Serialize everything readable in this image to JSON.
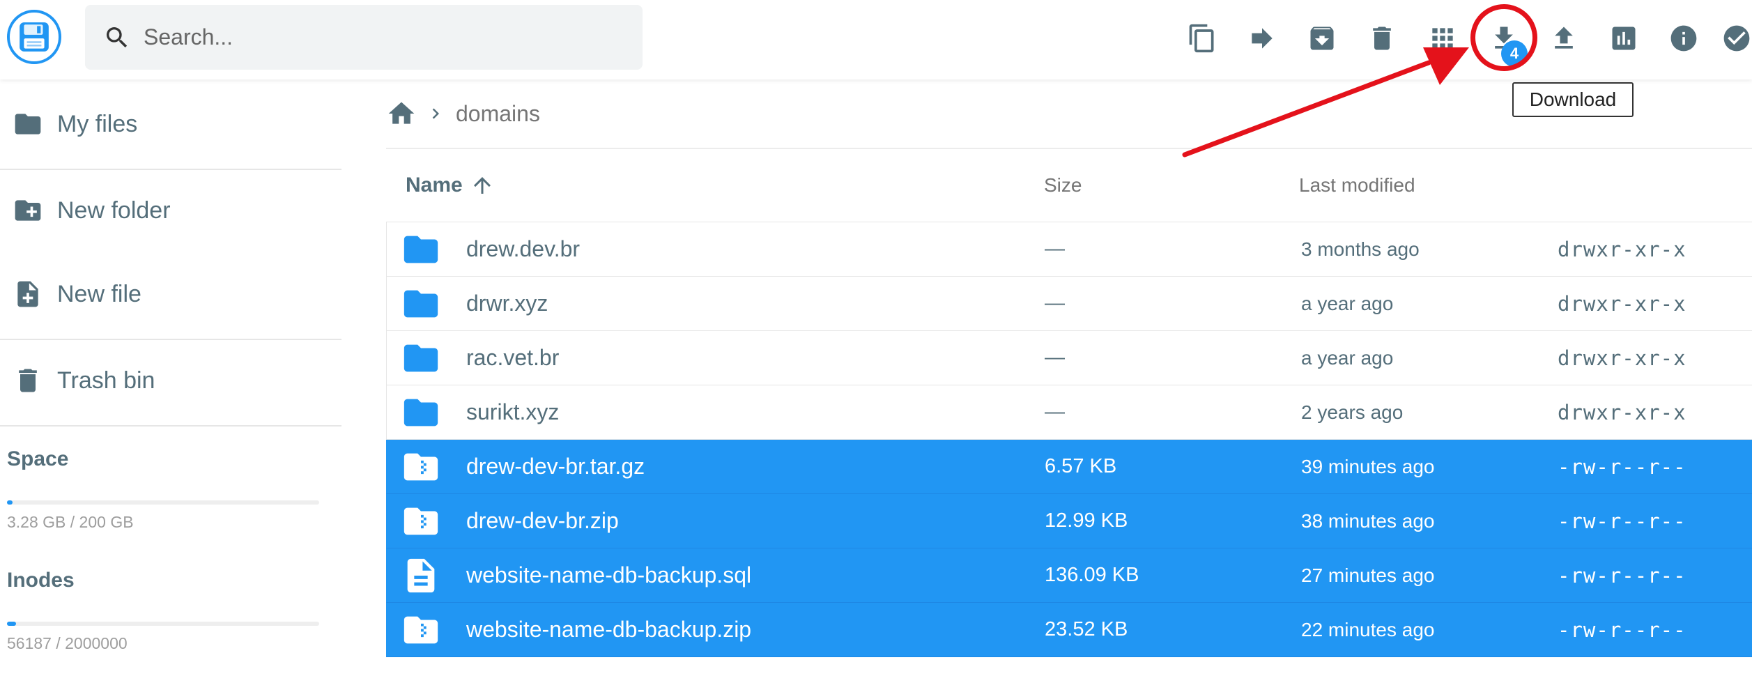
{
  "header": {
    "search_placeholder": "Search...",
    "download_badge": "4",
    "tooltip": "Download",
    "actions": [
      "copy",
      "move",
      "archive",
      "delete",
      "switch-view",
      "download",
      "upload",
      "disk-usage",
      "info",
      "select-multiple"
    ]
  },
  "sidebar": {
    "items": [
      {
        "label": "My files",
        "icon": "folder-icon"
      },
      {
        "label": "New folder",
        "icon": "create-new-folder-icon"
      },
      {
        "label": "New file",
        "icon": "note-add-icon"
      },
      {
        "label": "Trash bin",
        "icon": "trash-icon"
      }
    ],
    "space": {
      "title": "Space",
      "text": "3.28 GB / 200 GB",
      "fraction": 0.0164
    },
    "inodes": {
      "title": "Inodes",
      "text": "56187 / 2000000",
      "fraction": 0.0281
    }
  },
  "breadcrumb": {
    "current": "domains"
  },
  "table": {
    "columns": {
      "name": "Name",
      "size": "Size",
      "modified": "Last modified"
    },
    "rows": [
      {
        "name": "drew.dev.br",
        "size": "—",
        "modified": "3 months ago",
        "perm": "drwxr-xr-x",
        "type": "folder",
        "selected": false
      },
      {
        "name": "drwr.xyz",
        "size": "—",
        "modified": "a year ago",
        "perm": "drwxr-xr-x",
        "type": "folder",
        "selected": false
      },
      {
        "name": "rac.vet.br",
        "size": "—",
        "modified": "a year ago",
        "perm": "drwxr-xr-x",
        "type": "folder",
        "selected": false
      },
      {
        "name": "surikt.xyz",
        "size": "—",
        "modified": "2 years ago",
        "perm": "drwxr-xr-x",
        "type": "folder",
        "selected": false
      },
      {
        "name": "drew-dev-br.tar.gz",
        "size": "6.57 KB",
        "modified": "39 minutes ago",
        "perm": "-rw-r--r--",
        "type": "archive",
        "selected": true
      },
      {
        "name": "drew-dev-br.zip",
        "size": "12.99 KB",
        "modified": "38 minutes ago",
        "perm": "-rw-r--r--",
        "type": "archive",
        "selected": true
      },
      {
        "name": "website-name-db-backup.sql",
        "size": "136.09 KB",
        "modified": "27 minutes ago",
        "perm": "-rw-r--r--",
        "type": "document",
        "selected": true
      },
      {
        "name": "website-name-db-backup.zip",
        "size": "23.52 KB",
        "modified": "22 minutes ago",
        "perm": "-rw-r--r--",
        "type": "archive",
        "selected": true
      }
    ]
  },
  "colors": {
    "accent": "#2196f3",
    "annotation": "#e4121b",
    "icon": "#546e7a"
  }
}
